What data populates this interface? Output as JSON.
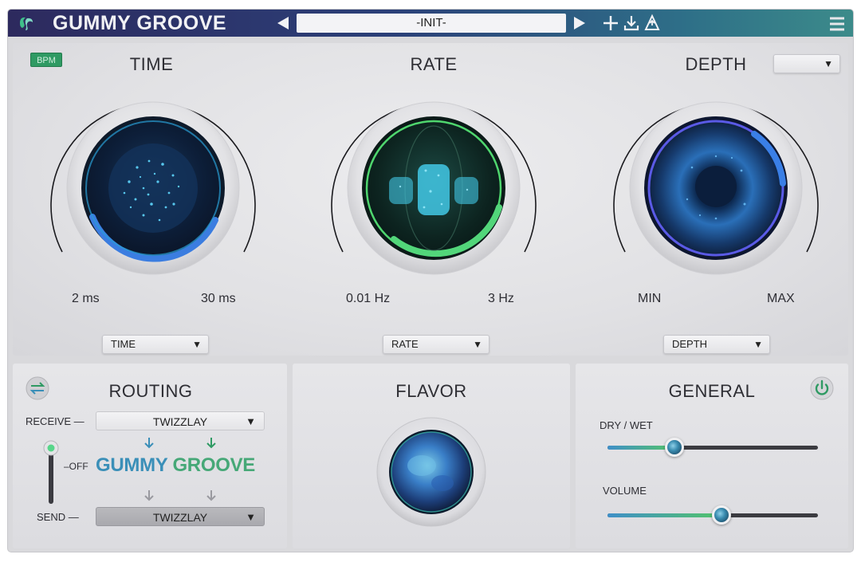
{
  "header": {
    "app_title": "GUMMY GROOVE",
    "preset_name": "-INIT-",
    "icons": [
      "logo-icon",
      "prev-arrow-icon",
      "next-arrow-icon",
      "add-icon",
      "download-icon",
      "share-icon",
      "menu-icon"
    ]
  },
  "top": {
    "bpm_label": "BPM",
    "time": {
      "title": "TIME",
      "min_label": "2 ms",
      "max_label": "30 ms",
      "select_label": "TIME"
    },
    "rate": {
      "title": "RATE",
      "min_label": "0.01 Hz",
      "max_label": "3 Hz",
      "select_label": "RATE"
    },
    "depth": {
      "title": "DEPTH",
      "min_label": "MIN",
      "max_label": "MAX",
      "select_label": "DEPTH",
      "mode_select_value": ""
    }
  },
  "routing": {
    "title": "ROUTING",
    "receive_label": "RECEIVE —",
    "receive_value": "TWIZZLAY",
    "send_label": "SEND —",
    "send_value": "TWIZZLAY",
    "off_label": "–OFF",
    "brand_part1": "GUMMY",
    "brand_part2": "GROOVE"
  },
  "flavor": {
    "title": "FLAVOR"
  },
  "general": {
    "title": "GENERAL",
    "dry_wet_label": "DRY / WET",
    "dry_wet_value": 0.32,
    "volume_label": "VOLUME",
    "volume_value": 0.54
  },
  "colors": {
    "header_start": "#2d2a5e",
    "header_end": "#3c8b8a",
    "accent_green": "#2f9a63",
    "accent_blue": "#3a8fb8",
    "knob_glow": "#34c8f0"
  }
}
